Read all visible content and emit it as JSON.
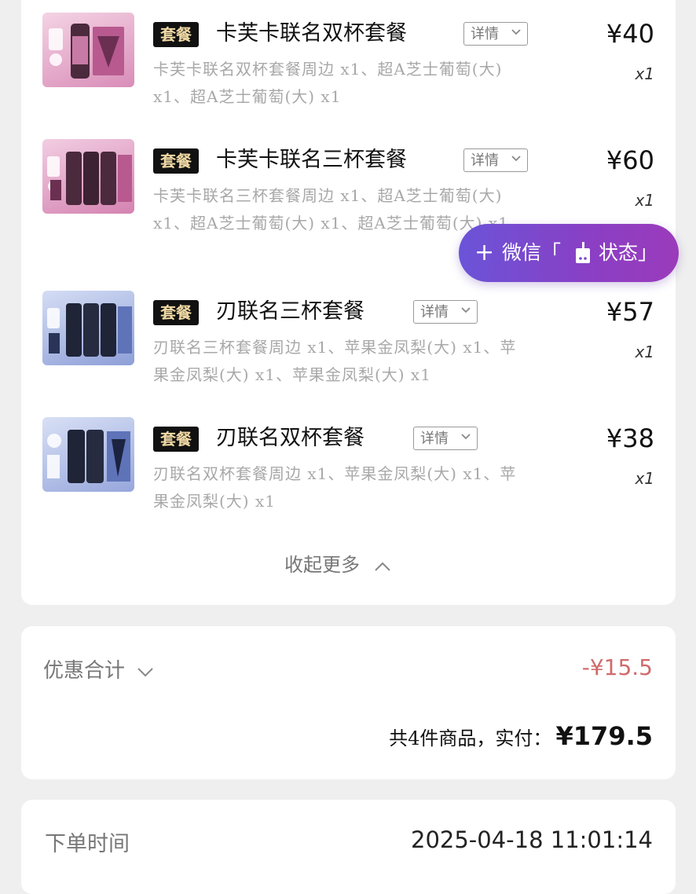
{
  "items": [
    {
      "tag": "套餐",
      "name": "卡芙卡联名双杯套餐",
      "detail": "详情",
      "price": "¥40",
      "qty": "x1",
      "desc": "卡芙卡联名双杯套餐周边 x1、超A芝士葡萄(大) x1、超A芝士葡萄(大) x1",
      "thumb_color": "#e6a9c9"
    },
    {
      "tag": "套餐",
      "name": "卡芙卡联名三杯套餐",
      "detail": "详情",
      "price": "¥60",
      "qty": "x1",
      "desc": "卡芙卡联名三杯套餐周边 x1、超A芝士葡萄(大) x1、超A芝士葡萄(大) x1、超A芝士葡萄(大) x1",
      "thumb_color": "#e2a3c6"
    },
    {
      "tag": "套餐",
      "name": "刃联名三杯套餐",
      "detail": "详情",
      "price": "¥57",
      "qty": "x1",
      "desc": "刃联名三杯套餐周边 x1、苹果金凤梨(大) x1、苹果金凤梨(大) x1、苹果金凤梨(大) x1",
      "thumb_color": "#a9b8e6"
    },
    {
      "tag": "套餐",
      "name": "刃联名双杯套餐",
      "detail": "详情",
      "price": "¥38",
      "qty": "x1",
      "desc": "刃联名双杯套餐周边 x1、苹果金凤梨(大) x1、苹果金凤梨(大) x1",
      "thumb_color": "#aebbe6"
    }
  ],
  "collapse_label": "收起更多",
  "floating": {
    "plus": "+",
    "label_left": "微信「",
    "label_right": "状态」"
  },
  "summary": {
    "discount_label": "优惠合计",
    "discount_value": "-¥15.5",
    "total_label": "共4件商品，实付：",
    "total_value": "¥179.5"
  },
  "order_time": {
    "label": "下单时间",
    "value": "2025-04-18 11:01:14"
  },
  "colors": {
    "tag_bg": "#111111",
    "tag_text": "#f0d9a4",
    "discount": "#d06a6a",
    "float_start": "#6a54d8",
    "float_end": "#9b3bbb"
  }
}
